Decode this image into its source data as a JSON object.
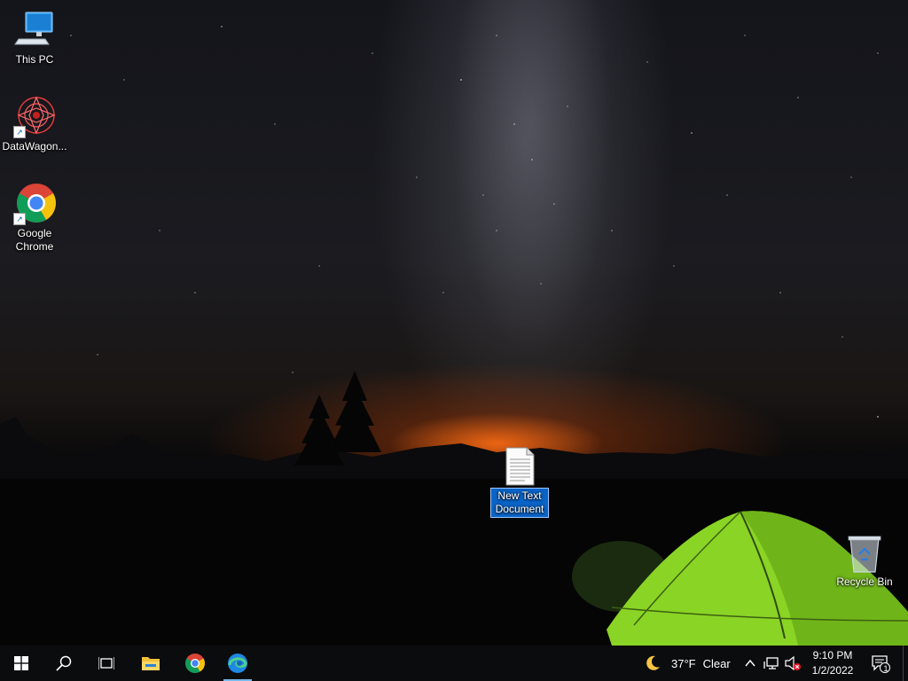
{
  "desktop": {
    "icons": [
      {
        "label": "This PC",
        "icon": "this-pc-icon"
      },
      {
        "label": "DataWagon...",
        "icon": "datawagon-icon"
      },
      {
        "label_line1": "Google",
        "label_line2": "Chrome",
        "icon": "chrome-icon"
      },
      {
        "label_line1": "New Text",
        "label_line2": "Document",
        "icon": "text-document-icon"
      },
      {
        "label": "Recycle Bin",
        "icon": "recycle-bin-icon"
      }
    ]
  },
  "taskbar": {
    "pinned": [
      "start-icon",
      "search-icon",
      "task-view-icon",
      "file-explorer-icon",
      "chrome-icon",
      "edge-icon"
    ],
    "weather": {
      "temp": "37°F",
      "condition": "Clear",
      "icon": "moon-icon"
    },
    "clock": {
      "time": "9:10 PM",
      "date": "1/2/2022"
    },
    "notifications": {
      "count": "1"
    },
    "accent": "#76b9ed",
    "background": "#0b0c0e"
  }
}
